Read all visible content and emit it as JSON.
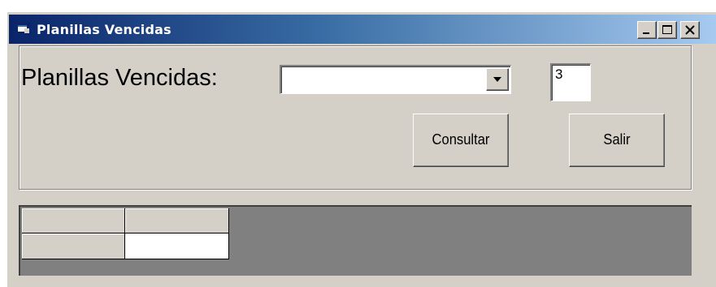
{
  "window": {
    "title": "Planillas Vencidas",
    "caption_buttons": [
      "minimize",
      "maximize",
      "close"
    ]
  },
  "form": {
    "label": "Planillas Vencidas:",
    "combo_value": "",
    "count_value": "3",
    "consultar_label": "Consultar",
    "salir_label": "Salir"
  },
  "grid": {
    "rows": [
      [
        "",
        ""
      ],
      [
        "",
        ""
      ]
    ]
  },
  "colors": {
    "titlebar_start": "#0a246a",
    "titlebar_end": "#a6caf0",
    "face": "#d4d0c8",
    "grid_background": "#808080"
  }
}
